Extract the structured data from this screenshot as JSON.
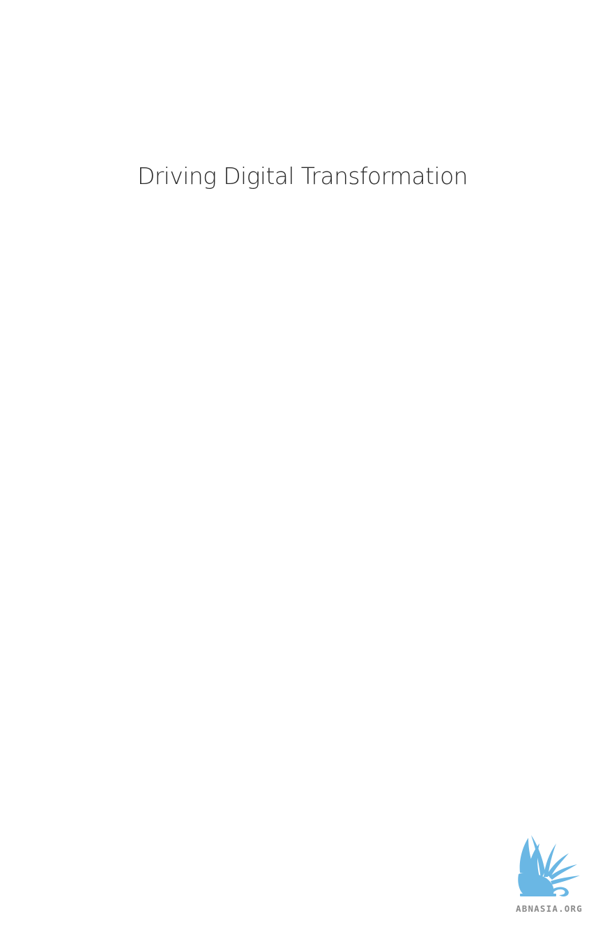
{
  "page": {
    "title": "Driving Digital Transformation",
    "background": "#ffffff",
    "text_color": "#2a2a2a"
  },
  "watermark": {
    "text": "ABNASIA.ORG",
    "icon": "griffin-logo-icon",
    "logo_color": "#6ab7e4",
    "text_color": "#8a8a8a"
  }
}
